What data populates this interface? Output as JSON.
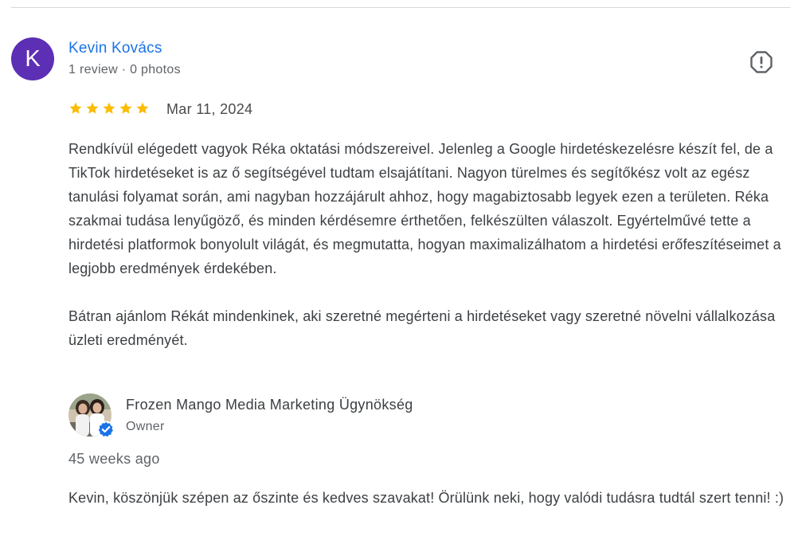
{
  "review": {
    "avatar_letter": "K",
    "avatar_color": "#5c2fb5",
    "reviewer_name": "Kevin Kovács",
    "reviewer_meta": "1 review · 0 photos",
    "flag_icon": "report-flag-icon",
    "rating": 5,
    "rating_max": 5,
    "star_color": "#fbbc04",
    "date": "Mar 11, 2024",
    "paragraphs": [
      "Rendkívül elégedett vagyok Réka oktatási módszereivel. Jelenleg a Google hirdetéskezelésre készít fel, de a TikTok hirdetéseket is az ő segítségével tudtam elsajátítani. Nagyon türelmes és segítőkész volt az egész tanulási folyamat során, ami nagyban hozzájárult ahhoz, hogy magabiztosabb legyek ezen a területen. Réka szakmai tudása lenyűgöző, és minden kérdésemre érthetően, felkészülten válaszolt. Egyértelművé tette a hirdetési platformok bonyolult világát, és megmutatta, hogyan maximalizálhatom a hirdetési erőfeszítéseimet a legjobb eredmények érdekében.",
      "Bátran ajánlom Rékát mindenkinek, aki szeretné megérteni a hirdetéseket vagy szeretné növelni vállalkozása üzleti eredményét."
    ]
  },
  "reply": {
    "owner_name": "Frozen Mango Media Marketing Ügynökség",
    "owner_role": "Owner",
    "verified_icon": "verified-badge-icon",
    "verified_color": "#1a73e8",
    "date": "45 weeks ago",
    "text": "Kevin, köszönjük szépen az őszinte és kedves szavakat! Örülünk neki, hogy valódi tudásra tudtál szert tenni! :)"
  }
}
